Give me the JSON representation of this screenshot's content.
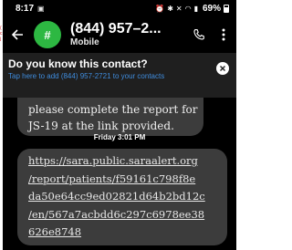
{
  "status_bar": {
    "time": "8:17",
    "battery": "69%"
  },
  "header": {
    "avatar_initial": "#",
    "phone_number": "(844) 957–2...",
    "number_type": "Mobile"
  },
  "banner": {
    "title": "Do you know this contact?",
    "subtitle": "Tap here to add (844) 957-2721 to your contacts"
  },
  "messages": {
    "previous_lines": [
      "please complete the report for",
      "JS-19 at the link provided."
    ],
    "timestamp": "Friday 3:01 PM",
    "link_lines": [
      "https://sara.public.saraalert.org",
      "/report/patients/f59161c798f8e",
      "da50e64cc9ed02821d64b2bd12c",
      "/en/567a7acbdd6c297c6978ee38",
      "626e8748"
    ]
  },
  "icons": {
    "back": "arrow-left-icon",
    "call": "phone-icon",
    "more": "more-vertical-icon",
    "close": "close-icon"
  },
  "colors": {
    "background": "#000000",
    "avatar": "#2db842",
    "bubble": "#3c3c3c",
    "banner_link": "#3f8cdd"
  }
}
